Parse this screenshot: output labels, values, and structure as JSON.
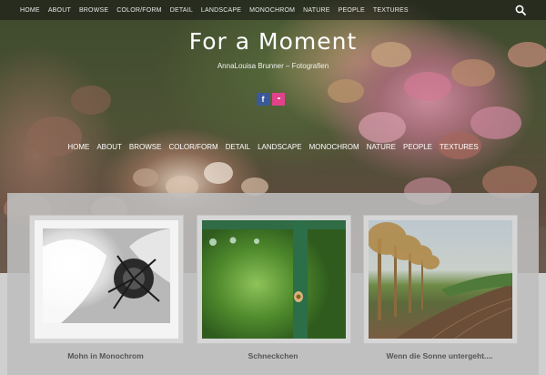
{
  "top_nav": [
    "HOME",
    "ABOUT",
    "BROWSE",
    "COLOR/FORM",
    "DETAIL",
    "LANDSCAPE",
    "MONOCHROM",
    "NATURE",
    "PEOPLE",
    "TEXTURES"
  ],
  "site": {
    "title": "For a Moment",
    "tagline": "AnnaLouisa Brunner – Fotografien"
  },
  "social": {
    "facebook_glyph": "f",
    "flickr_glyph": "••"
  },
  "main_nav": [
    "HOME",
    "ABOUT",
    "BROWSE",
    "COLOR/FORM",
    "DETAIL",
    "LANDSCAPE",
    "MONOCHROM",
    "NATURE",
    "PEOPLE",
    "TEXTURES"
  ],
  "posts": [
    {
      "title": "Mohn in Monochrom",
      "image": "monochrome-poppy-photo"
    },
    {
      "title": "Schneckchen",
      "image": "snail-on-green-fence-photo"
    },
    {
      "title": "Wenn die Sonne untergeht....",
      "image": "tree-lined-country-road-photo"
    }
  ],
  "colors": {
    "facebook": "#3b5998",
    "flickr": "#e0428b",
    "caption": "#555555"
  },
  "icons": {
    "search": "search-icon"
  }
}
